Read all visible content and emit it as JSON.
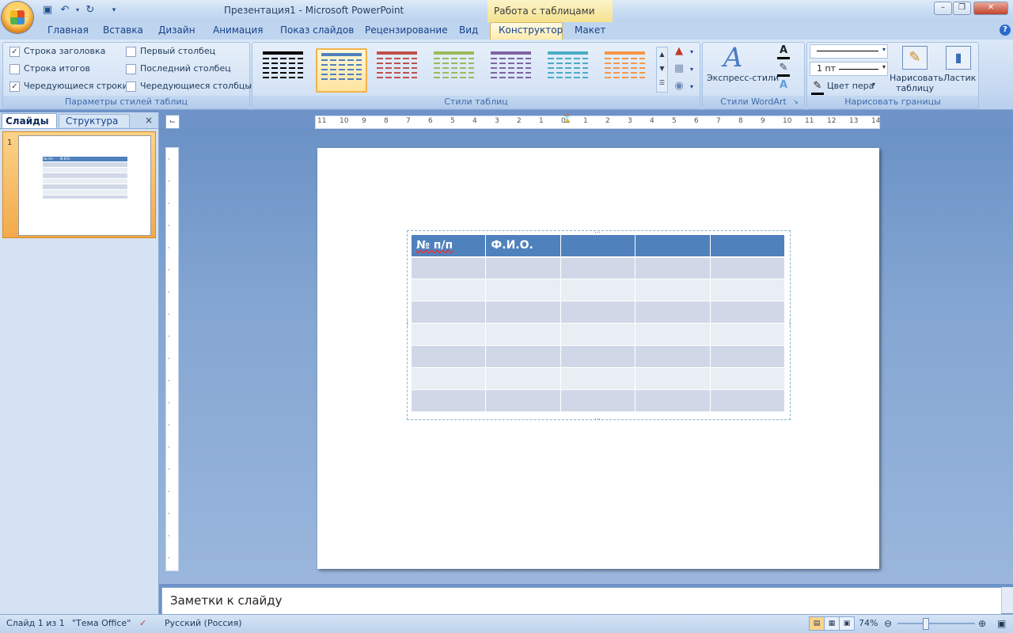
{
  "window": {
    "title": "Презентация1 - Microsoft PowerPoint",
    "contextual_group": "Работа с таблицами"
  },
  "tabs": [
    "Главная",
    "Вставка",
    "Дизайн",
    "Анимация",
    "Показ слайдов",
    "Рецензирование",
    "Вид",
    "Конструктор",
    "Макет"
  ],
  "active_tab": "Конструктор",
  "ribbon": {
    "options_group": {
      "label": "Параметры стилей таблиц",
      "checkboxes": [
        {
          "label": "Строка заголовка",
          "checked": true
        },
        {
          "label": "Строка итогов",
          "checked": false
        },
        {
          "label": "Чередующиеся строки",
          "checked": true
        },
        {
          "label": "Первый столбец",
          "checked": false
        },
        {
          "label": "Последний столбец",
          "checked": false
        },
        {
          "label": "Чередующиеся столбцы",
          "checked": false
        }
      ]
    },
    "styles_group": {
      "label": "Стили таблиц",
      "swatch_colors": [
        "#000000",
        "#4f81bd",
        "#c0504d",
        "#9bbb59",
        "#8064a2",
        "#4bacc6",
        "#f79646"
      ]
    },
    "wordart_group": {
      "label": "Стили WordArt",
      "quick_styles": "Экспресс-стили"
    },
    "borders_group": {
      "label": "Нарисовать границы",
      "pen_weight": "1 пт",
      "pen_color": "Цвет пера",
      "draw_table": "Нарисовать таблицу",
      "eraser": "Ластик"
    }
  },
  "slides_pane": {
    "tab_slides": "Слайды",
    "tab_outline": "Структура",
    "slide_number": "1",
    "thumb_header": [
      "№ п/п",
      "Ф.И.О."
    ]
  },
  "ruler_labels": [
    "11",
    "10",
    "9",
    "8",
    "7",
    "6",
    "5",
    "4",
    "3",
    "2",
    "1",
    "0",
    "1",
    "2",
    "3",
    "4",
    "5",
    "6",
    "7",
    "8",
    "9",
    "10",
    "11",
    "12",
    "13",
    "14"
  ],
  "table": {
    "header": [
      "№ п/п",
      "Ф.И.О.",
      "",
      "",
      ""
    ],
    "body_rows": 7
  },
  "notes_placeholder": "Заметки к слайду",
  "status": {
    "slide_info": "Слайд 1 из 1",
    "theme": "\"Тема Office\"",
    "language": "Русский (Россия)",
    "zoom": "74%"
  }
}
